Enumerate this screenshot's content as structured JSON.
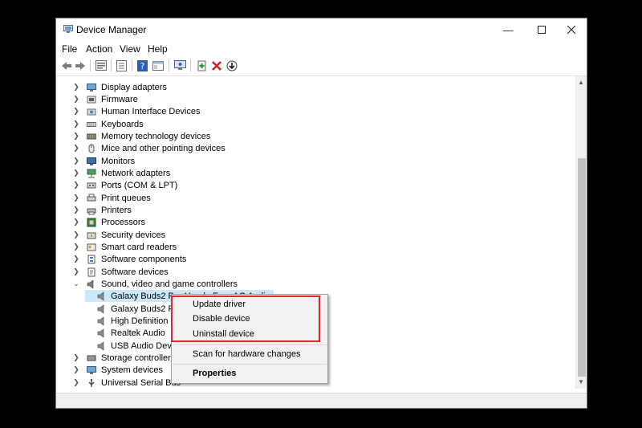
{
  "window": {
    "title": "Device Manager"
  },
  "menu": [
    "File",
    "Action",
    "View",
    "Help"
  ],
  "toolbar_icons": [
    "back-arrow-icon",
    "forward-arrow-icon",
    "properties-icon",
    "device-list-icon",
    "help-icon",
    "view-icon",
    "monitor-scan-icon",
    "add-driver-icon",
    "remove-device-icon",
    "download-icon"
  ],
  "tree": [
    {
      "label": "Display adapters",
      "icon": "display-adapter-icon",
      "expanded": false
    },
    {
      "label": "Firmware",
      "icon": "firmware-icon",
      "expanded": false
    },
    {
      "label": "Human Interface Devices",
      "icon": "hid-icon",
      "expanded": false
    },
    {
      "label": "Keyboards",
      "icon": "keyboard-icon",
      "expanded": false
    },
    {
      "label": "Memory technology devices",
      "icon": "memory-icon",
      "expanded": false
    },
    {
      "label": "Mice and other pointing devices",
      "icon": "mouse-icon",
      "expanded": false
    },
    {
      "label": "Monitors",
      "icon": "monitor-icon",
      "expanded": false
    },
    {
      "label": "Network adapters",
      "icon": "network-icon",
      "expanded": false
    },
    {
      "label": "Ports (COM & LPT)",
      "icon": "port-icon",
      "expanded": false
    },
    {
      "label": "Print queues",
      "icon": "print-queue-icon",
      "expanded": false
    },
    {
      "label": "Printers",
      "icon": "printer-icon",
      "expanded": false
    },
    {
      "label": "Processors",
      "icon": "processor-icon",
      "expanded": false
    },
    {
      "label": "Security devices",
      "icon": "security-icon",
      "expanded": false
    },
    {
      "label": "Smart card readers",
      "icon": "smart-card-icon",
      "expanded": false
    },
    {
      "label": "Software components",
      "icon": "software-component-icon",
      "expanded": false
    },
    {
      "label": "Software devices",
      "icon": "software-device-icon",
      "expanded": false
    },
    {
      "label": "Sound, video and game controllers",
      "icon": "sound-icon",
      "expanded": true,
      "children": [
        {
          "label": "Galaxy Buds2 Pro Hands-Free AG Audio",
          "icon": "speaker-icon",
          "selected": true
        },
        {
          "label": "Galaxy Buds2 Pr",
          "icon": "speaker-icon"
        },
        {
          "label": "High Definition",
          "icon": "speaker-icon"
        },
        {
          "label": "Realtek Audio",
          "icon": "speaker-icon"
        },
        {
          "label": "USB Audio Devic",
          "icon": "speaker-icon"
        }
      ]
    },
    {
      "label": "Storage controllers",
      "icon": "storage-icon",
      "expanded": false
    },
    {
      "label": "System devices",
      "icon": "system-icon",
      "expanded": false
    },
    {
      "label": "Universal Serial Bus",
      "icon": "usb-icon",
      "expanded": false
    }
  ],
  "context_menu": {
    "update": "Update driver",
    "disable": "Disable device",
    "uninstall": "Uninstall device",
    "scan": "Scan for hardware changes",
    "properties": "Properties"
  },
  "colors": {
    "highlight_box": "#e0262d",
    "selection": "#cce8ff"
  }
}
